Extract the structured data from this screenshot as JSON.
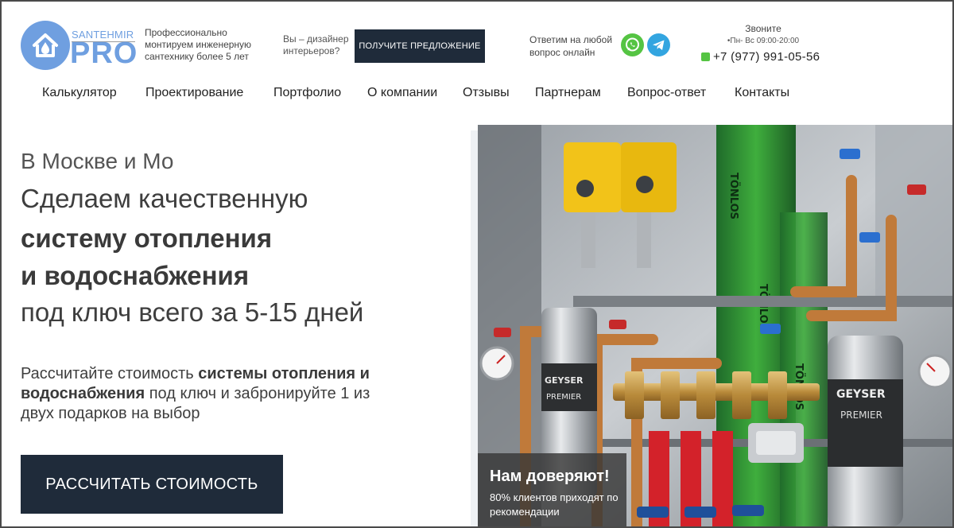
{
  "brand": {
    "sub": "SANTEHMIR",
    "name": "PRO",
    "accent_color": "#6f9fe0",
    "icon": "house-drop-icon"
  },
  "header": {
    "tagline": "Профессионально монтируем инженерную сантехнику более 5 лет",
    "designer_text": "Вы – дизайнер интерьеров?",
    "offer_button": "ПОЛУЧИТЕ ПРЕДЛОЖЕНИЕ",
    "answer_text": "Ответим на любой вопрос онлайн",
    "messengers": [
      "whatsapp-icon",
      "telegram-icon"
    ],
    "call_label": "Звоните",
    "hours": "•Пн- Вс 09:00-20:00",
    "phone": "+7 (977) 991-05-56"
  },
  "nav": {
    "items": [
      "Калькулятор",
      "Проектирование",
      "Портфолио",
      "О компании",
      "Отзывы",
      "Партнерам",
      "Вопрос-ответ",
      "Контакты"
    ]
  },
  "hero": {
    "line1": "В Москве и Мо",
    "line2": "Сделаем качественную",
    "line3": "систему отопления",
    "line4": "и водоснабжения",
    "line5": "под ключ всего за 5-15 дней",
    "calc_part1": "Рассчитайте стоимость ",
    "calc_bold": "системы отопления и водоснабжения",
    "calc_part2": " под ключ и забронируйте 1 из двух подарков на выбор",
    "cta": "РАССЧИТАТЬ СТОИМОСТЬ"
  },
  "photo": {
    "labels": [
      "GEYSER",
      "PREMIER",
      "TÖNLOS"
    ]
  },
  "trust": {
    "title": "Нам доверяют!",
    "subtitle": "80% клиентов приходят по рекомендации"
  },
  "colors": {
    "dark_button": "#1f2b3a",
    "whatsapp": "#55c443",
    "telegram": "#33a5e0"
  }
}
